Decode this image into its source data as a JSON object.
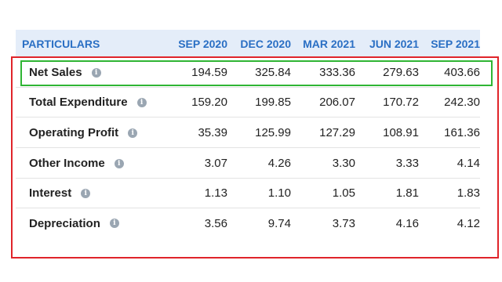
{
  "table": {
    "header": {
      "label": "PARTICULARS",
      "periods": [
        "SEP 2020",
        "DEC 2020",
        "MAR 2021",
        "JUN 2021",
        "SEP 2021"
      ]
    },
    "rows": [
      {
        "label": "Net Sales",
        "values": [
          "194.59",
          "325.84",
          "333.36",
          "279.63",
          "403.66"
        ]
      },
      {
        "label": "Total Expenditure",
        "values": [
          "159.20",
          "199.85",
          "206.07",
          "170.72",
          "242.30"
        ]
      },
      {
        "label": "Operating Profit",
        "values": [
          "35.39",
          "125.99",
          "127.29",
          "108.91",
          "161.36"
        ]
      },
      {
        "label": "Other Income",
        "values": [
          "3.07",
          "4.26",
          "3.30",
          "3.33",
          "4.14"
        ]
      },
      {
        "label": "Interest",
        "values": [
          "1.13",
          "1.10",
          "1.05",
          "1.81",
          "1.83"
        ]
      },
      {
        "label": "Depreciation",
        "values": [
          "3.56",
          "9.74",
          "3.73",
          "4.16",
          "4.12"
        ]
      }
    ]
  },
  "info_icon": {
    "glyph": "i",
    "icon": "info-icon",
    "color": "#9aa6b2"
  },
  "colors": {
    "header_background": "#e4edf9",
    "header_text": "#2a6fc4",
    "highlight_red": "#e0242a",
    "highlight_green": "#2fb534"
  }
}
